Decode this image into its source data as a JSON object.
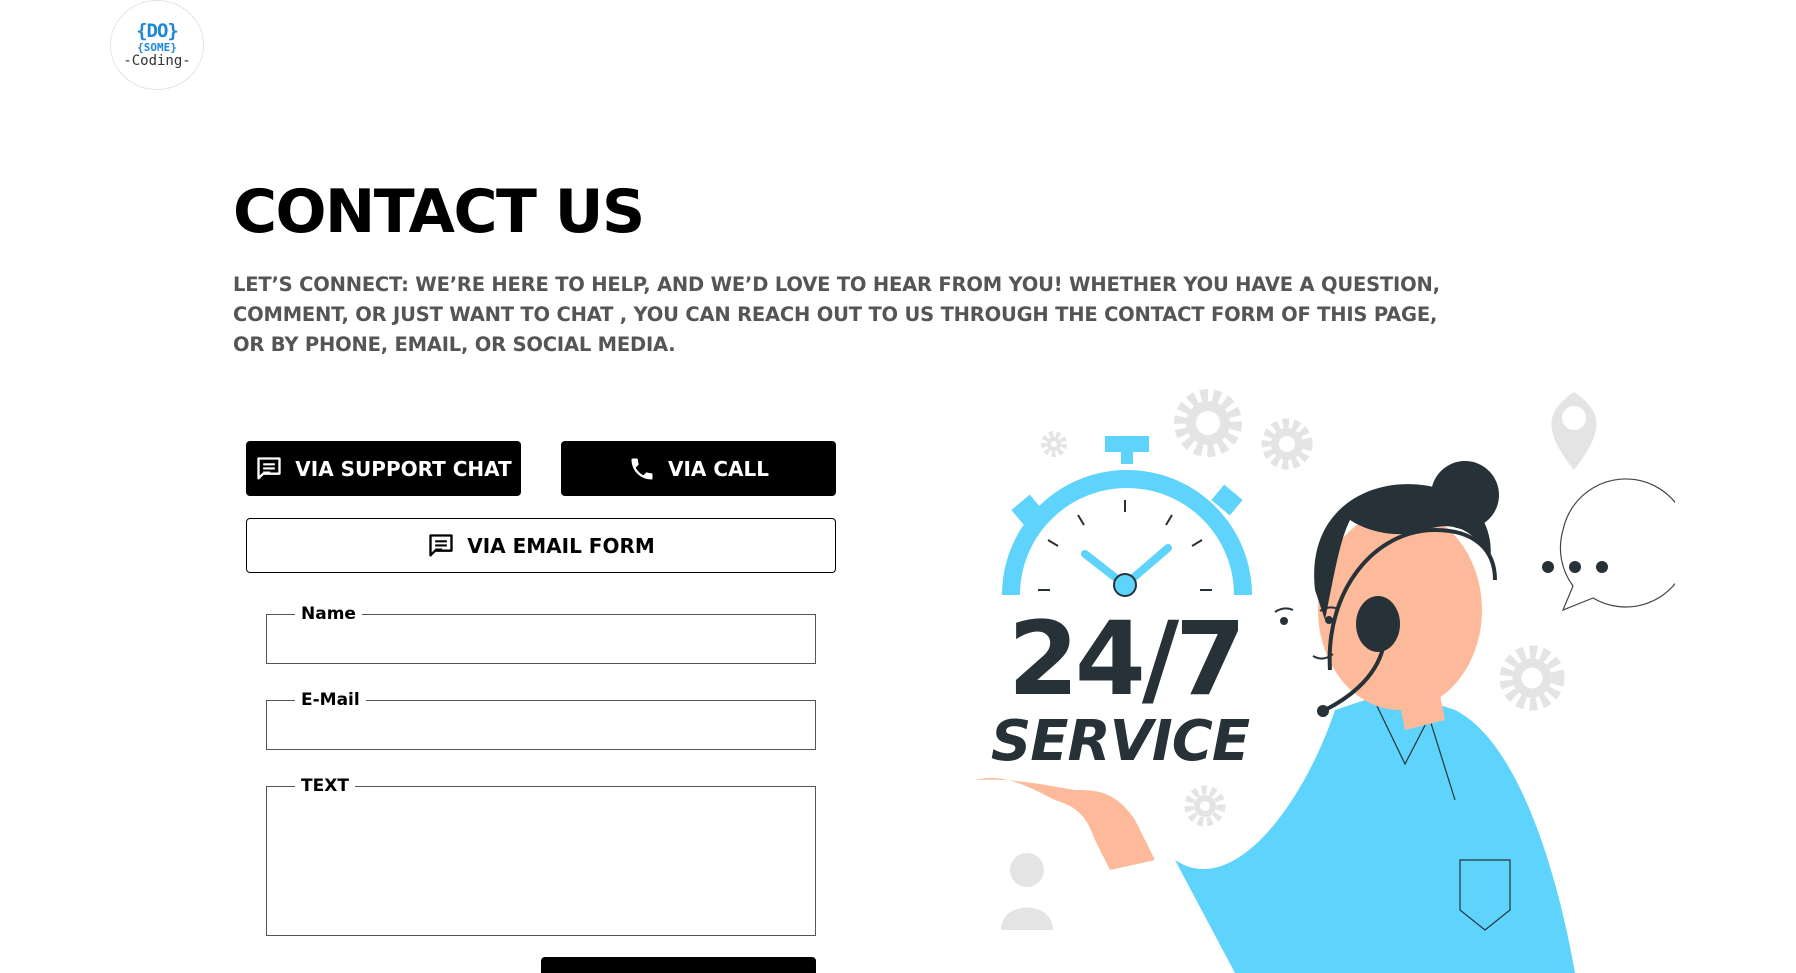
{
  "logo": {
    "line1": "{DO}",
    "line2": "{SOME}",
    "line3": "-Coding-"
  },
  "header": {
    "title": "CONTACT US",
    "intro": "LET’S CONNECT: WE’RE HERE TO HELP, AND WE’D LOVE TO HEAR FROM YOU! WHETHER YOU HAVE A QUESTION, COMMENT, OR JUST WANT TO CHAT , YOU CAN REACH OUT TO US THROUGH THE CONTACT FORM OF THIS PAGE, OR BY PHONE, EMAIL, OR SOCIAL MEDIA."
  },
  "contact_options": {
    "support_chat_label": "VIA SUPPORT CHAT",
    "call_label": "VIA CALL",
    "email_form_label": "VIA EMAIL FORM"
  },
  "form": {
    "name_label": "Name",
    "name_value": "",
    "email_label": "E-Mail",
    "email_value": "",
    "text_label": "TEXT",
    "text_value": ""
  },
  "illustration": {
    "headline": "24/7",
    "subline": "SERVICE",
    "icons": [
      "stopwatch-icon",
      "gear-icon",
      "location-pin-icon",
      "chat-bubble-icon",
      "user-icon"
    ]
  },
  "colors": {
    "accent": "#5ed3fb",
    "dark": "#263238",
    "text_gray": "#555555",
    "skin": "#fdba9a",
    "icon_gray": "#e4e4e4"
  }
}
